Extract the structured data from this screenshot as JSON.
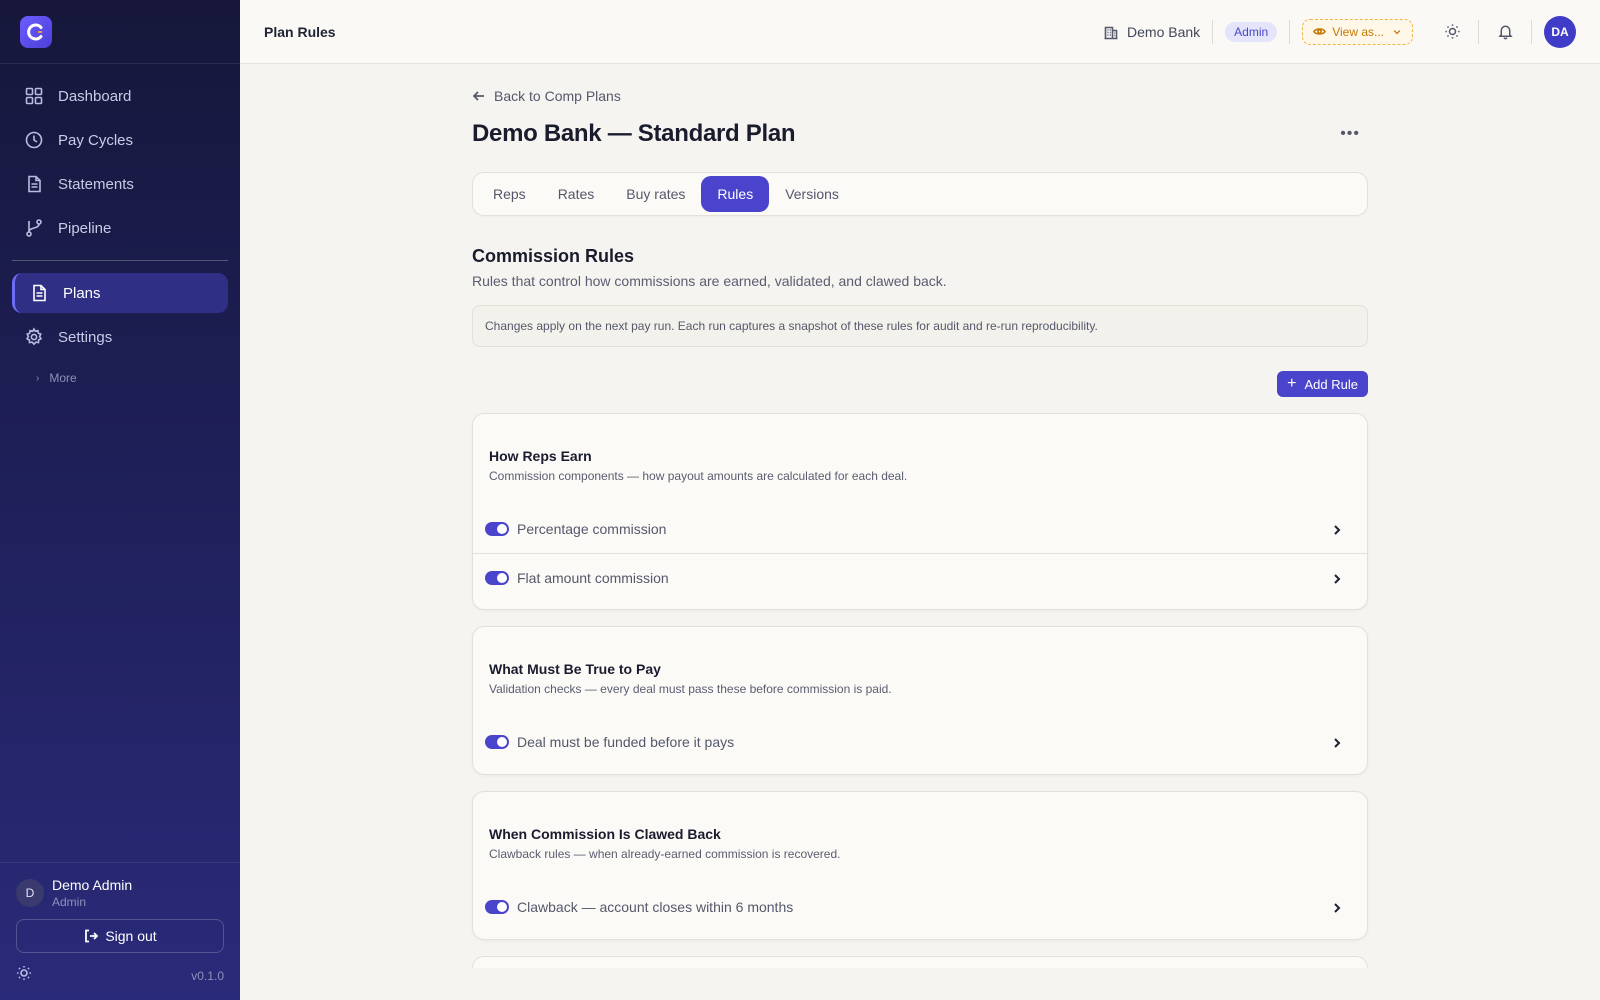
{
  "topbar": {
    "title": "Plan Rules",
    "org_name": "Demo Bank",
    "role_badge": "Admin",
    "view_as_label": "View as...",
    "avatar_initials": "DA"
  },
  "sidebar": {
    "items": [
      {
        "label": "Dashboard",
        "icon": "grid-icon"
      },
      {
        "label": "Pay Cycles",
        "icon": "clock-icon"
      },
      {
        "label": "Statements",
        "icon": "document-icon"
      },
      {
        "label": "Pipeline",
        "icon": "git-branch-icon"
      },
      {
        "label": "Plans",
        "icon": "document-icon",
        "active": true
      },
      {
        "label": "Settings",
        "icon": "gear-icon"
      }
    ],
    "more_label": "More",
    "user": {
      "initial": "D",
      "name": "Demo Admin",
      "role": "Admin"
    },
    "sign_out_label": "Sign out",
    "version": "v0.1.0"
  },
  "main": {
    "back_label": "Back to Comp Plans",
    "title": "Demo Bank — Standard Plan",
    "tabs": [
      {
        "label": "Reps"
      },
      {
        "label": "Rates"
      },
      {
        "label": "Buy rates"
      },
      {
        "label": "Rules",
        "active": true
      },
      {
        "label": "Versions"
      }
    ],
    "section_title": "Commission Rules",
    "section_subtitle": "Rules that control how commissions are earned, validated, and clawed back.",
    "notice": "Changes apply on the next pay run. Each run captures a snapshot of these rules for audit and re-run reproducibility.",
    "add_rule_label": "Add Rule",
    "cards": [
      {
        "title": "How Reps Earn",
        "subtitle": "Commission components — how payout amounts are calculated for each deal.",
        "rules": [
          {
            "label": "Percentage commission",
            "enabled": true
          },
          {
            "label": "Flat amount commission",
            "enabled": true
          }
        ]
      },
      {
        "title": "What Must Be True to Pay",
        "subtitle": "Validation checks — every deal must pass these before commission is paid.",
        "rules": [
          {
            "label": "Deal must be funded before it pays",
            "enabled": true
          }
        ]
      },
      {
        "title": "When Commission Is Clawed Back",
        "subtitle": "Clawback rules — when already-earned commission is recovered.",
        "rules": [
          {
            "label": "Clawback — account closes within 6 months",
            "enabled": true
          }
        ]
      }
    ]
  },
  "colors": {
    "accent": "#4a44cc",
    "sidebar_top": "#16173a",
    "sidebar_bottom": "#2a2a7a",
    "view_as": "#c57a07"
  }
}
